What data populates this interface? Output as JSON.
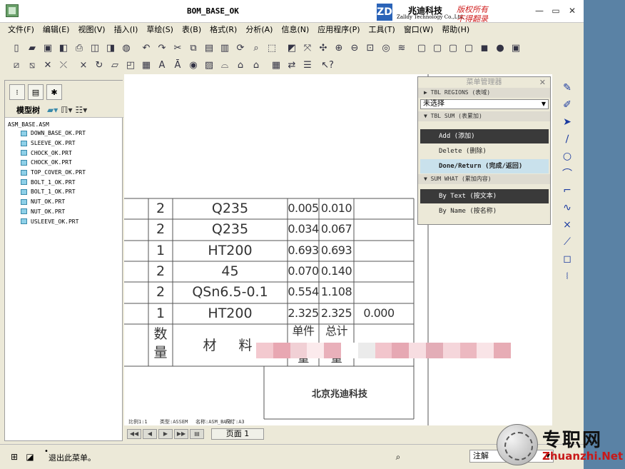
{
  "window": {
    "title": "BOM_BASE_OK",
    "brand_logo_text": "ZD",
    "brand_name": "兆迪科技",
    "brand_sub": "Zalldy Technology Co.,Ltd.",
    "brand_right1": "版权所有",
    "brand_right2": "不得翻录",
    "minimize": "—",
    "restore": "▭",
    "close": "✕"
  },
  "menubar": [
    "文件(F)",
    "编辑(E)",
    "视图(V)",
    "插入(I)",
    "草绘(S)",
    "表(B)",
    "格式(R)",
    "分析(A)",
    "信息(N)",
    "应用程序(P)",
    "工具(T)",
    "窗口(W)",
    "帮助(H)"
  ],
  "model_tree": {
    "label": "模型树",
    "root": "ASM_BASE.ASM",
    "items": [
      "DOWN_BASE_OK.PRT",
      "SLEEVE_OK.PRT",
      "CHOCK_OK.PRT",
      "CHOCK_OK.PRT",
      "TOP_COVER_OK.PRT",
      "BOLT_1_OK.PRT",
      "BOLT_1_OK.PRT",
      "NUT_OK.PRT",
      "NUT_OK.PRT",
      "USLEEVE_OK.PRT"
    ]
  },
  "bom_table": {
    "rows": [
      {
        "qty": "2",
        "material": "Q235",
        "unit": "0.005",
        "total": "0.010",
        "extra": ""
      },
      {
        "qty": "2",
        "material": "Q235",
        "unit": "0.034",
        "total": "0.067",
        "extra": ""
      },
      {
        "qty": "1",
        "material": "HT200",
        "unit": "0.693",
        "total": "0.693",
        "extra": ""
      },
      {
        "qty": "2",
        "material": "45",
        "unit": "0.070",
        "total": "0.140",
        "extra": ""
      },
      {
        "qty": "2",
        "material": "QSn6.5-0.1",
        "unit": "0.554",
        "total": "1.108",
        "extra": ""
      },
      {
        "qty": "1",
        "material": "HT200",
        "unit": "2.325",
        "total": "2.325",
        "extra": "0.000"
      }
    ],
    "header_qty_1": "数",
    "header_qty_2": "量",
    "header_mat_1": "材",
    "header_mat_2": "料",
    "header_unit_1": "单件",
    "header_unit_2": "量",
    "header_total_1": "总计",
    "header_total_2": "量",
    "company": "北京兆迪科技",
    "scale": "比例1:1",
    "type": "类型:ASSEM",
    "name": "名称:ASM_BASE",
    "size": "尺寸:A3"
  },
  "pagebar": {
    "page_tab": "页面 1"
  },
  "menu_manager": {
    "title": "菜单管理器",
    "tbl_regions": "TBL REGIONS (表域)",
    "select_value": "未选择",
    "tbl_sum": "TBL SUM (表累加)",
    "add": "Add (添加)",
    "delete": "Delete (删除)",
    "done": "Done/Return (完成/返回)",
    "sum_what": "SUM WHAT (累加内容)",
    "by_text": "By Text (按文本)",
    "by_name": "By Name (按名称)"
  },
  "statusbar": {
    "bullet": "•",
    "message": "退出此菜单。",
    "filter": "注解"
  },
  "watermark": {
    "cn": "专职网",
    "en": "Zhuanzhi.Net"
  }
}
